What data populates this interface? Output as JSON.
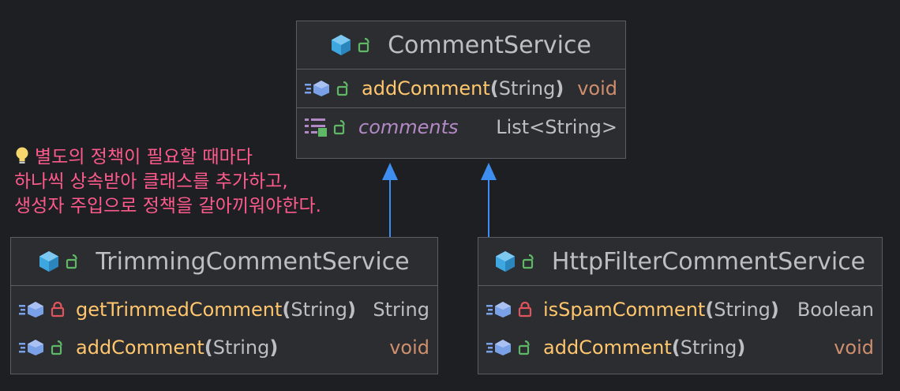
{
  "colors": {
    "background": "#1e1f22",
    "box_fill": "#2b2d30",
    "box_border": "#5a5d63",
    "method_name": "#ffc66d",
    "field_name": "#b389c5",
    "keyword_type": "#cf8e6d",
    "note_text": "#ff5a8c",
    "arrow": "#3d8ef0",
    "class_icon": "#3fa7e0",
    "unlock_icon": "#5fb865",
    "lock_icon": "#e0555c"
  },
  "classes": {
    "comment_service": {
      "name": "CommentService",
      "methods": [
        {
          "name": "addComment",
          "open": "(",
          "param": "String",
          "close": ")",
          "return": "void",
          "visibility": "public"
        }
      ],
      "fields": [
        {
          "name": "comments",
          "type": "List<String>",
          "visibility": "public"
        }
      ]
    },
    "trimming": {
      "name": "TrimmingCommentService",
      "methods": [
        {
          "name": "getTrimmedComment",
          "open": "(",
          "param": "String",
          "close": ")",
          "return": "String",
          "visibility": "private"
        },
        {
          "name": "addComment",
          "open": "(",
          "param": "String",
          "close": ")",
          "return": "void",
          "visibility": "public"
        }
      ]
    },
    "http_filter": {
      "name": "HttpFilterCommentService",
      "methods": [
        {
          "name": "isSpamComment",
          "open": "(",
          "param": "String",
          "close": ")",
          "return": "Boolean",
          "visibility": "private"
        },
        {
          "name": "addComment",
          "open": "(",
          "param": "String",
          "close": ")",
          "return": "void",
          "visibility": "public"
        }
      ]
    }
  },
  "note": {
    "icon": "lightbulb-icon",
    "lines": [
      "별도의 정책이 필요할 때마다",
      "하나씩 상속받아 클래스를 추가하고,",
      "생성자 주입으로 정책을 갈아끼워야한다."
    ]
  }
}
